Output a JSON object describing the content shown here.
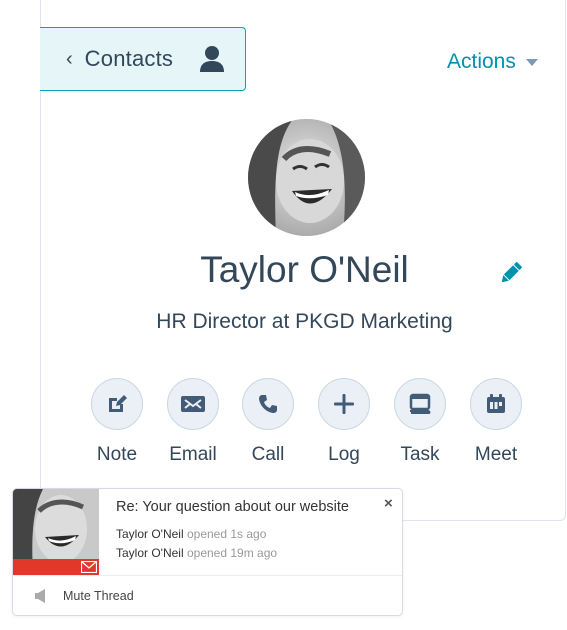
{
  "header": {
    "back_button_label": "Contacts",
    "back_icon": "chevron-left-icon",
    "contact_icon": "person-icon",
    "actions_label": "Actions",
    "actions_icon": "caret-down-icon"
  },
  "contact": {
    "avatar_alt": "Taylor O'Neil profile photo",
    "name": "Taylor O'Neil",
    "edit_icon": "pencil-icon",
    "subtitle": "HR Director at PKGD Marketing"
  },
  "quick_actions": [
    {
      "label": "Note",
      "icon": "note-edit-icon"
    },
    {
      "label": "Email",
      "icon": "envelope-icon"
    },
    {
      "label": "Call",
      "icon": "phone-icon"
    },
    {
      "label": "Log",
      "icon": "plus-icon"
    },
    {
      "label": "Task",
      "icon": "task-icon"
    },
    {
      "label": "Meet",
      "icon": "calendar-icon"
    }
  ],
  "notification": {
    "title": "Re: Your question about our website",
    "close_label": "×",
    "events": [
      {
        "who": "Taylor O'Neil",
        "what": "opened 1s ago"
      },
      {
        "who": "Taylor O'Neil",
        "what": "opened 19m ago"
      }
    ],
    "mute_label": "Mute Thread",
    "accent_color": "#e0392b"
  },
  "colors": {
    "primary_text": "#33475b",
    "link": "#0091ae",
    "contacts_bg": "#e5f5f8",
    "contacts_border": "#00a4bd",
    "action_circle_bg": "#eaf0f6"
  }
}
